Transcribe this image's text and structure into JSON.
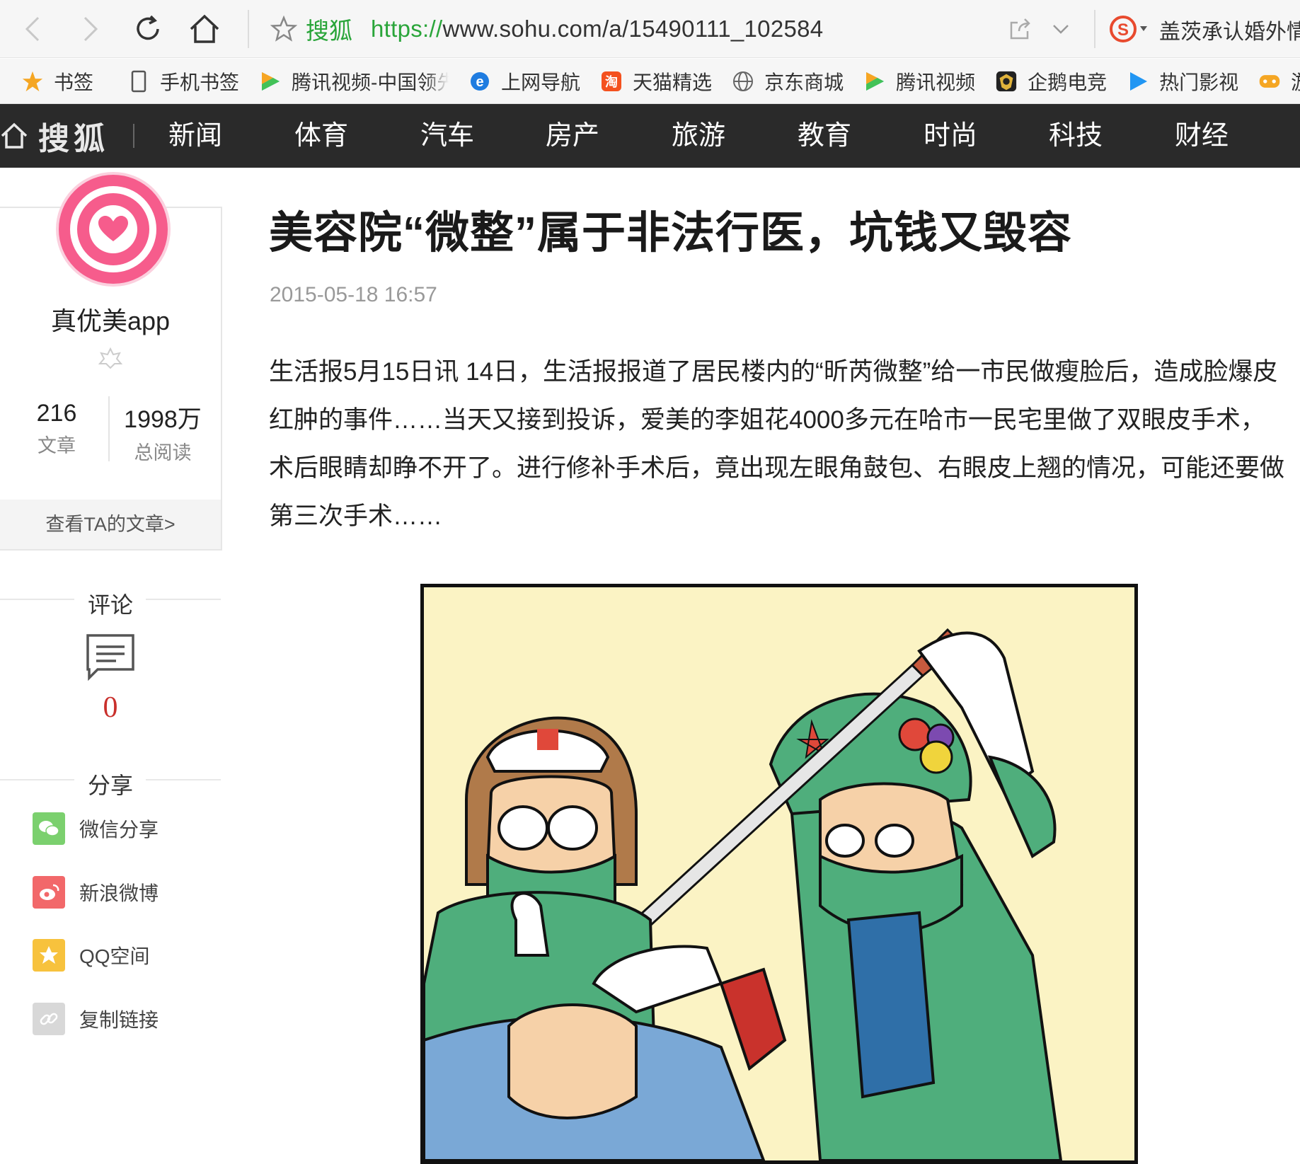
{
  "browser": {
    "site_name": "搜狐",
    "url_scheme": "https://",
    "url_rest": "www.sohu.com/a/15490111_102584",
    "news_ticker": "盖茨承认婚外情"
  },
  "bookmarks": [
    {
      "label": "书签",
      "icon": "star-icon"
    },
    {
      "label": "手机书签",
      "icon": "phone-icon"
    },
    {
      "label": "腾讯视频-中国领先",
      "icon": "tencent-video-icon"
    },
    {
      "label": "上网导航",
      "icon": "ie-icon"
    },
    {
      "label": "天猫精选",
      "icon": "taobao-icon"
    },
    {
      "label": "京东商城",
      "icon": "globe-icon"
    },
    {
      "label": "腾讯视频",
      "icon": "tencent-video-icon"
    },
    {
      "label": "企鹅电竞",
      "icon": "penguin-esports-icon"
    },
    {
      "label": "热门影视",
      "icon": "play-icon"
    },
    {
      "label": "游戏",
      "icon": "gamepad-icon"
    }
  ],
  "sitenav": {
    "logo": "搜狐",
    "items": [
      "新闻",
      "体育",
      "汽车",
      "房产",
      "旅游",
      "教育",
      "时尚",
      "科技",
      "财经"
    ]
  },
  "author": {
    "name": "真优美app",
    "articles_count": "216",
    "articles_label": "文章",
    "reads_count": "1998万",
    "reads_label": "总阅读",
    "view_link": "查看TA的文章>"
  },
  "comments": {
    "title": "评论",
    "count": "0"
  },
  "share": {
    "title": "分享",
    "items": [
      {
        "label": "微信分享",
        "color": "#7bd06e",
        "icon": "wechat-icon"
      },
      {
        "label": "新浪微博",
        "color": "#f2686a",
        "icon": "weibo-icon"
      },
      {
        "label": "QQ空间",
        "color": "#f7c23d",
        "icon": "qzone-icon"
      },
      {
        "label": "复制链接",
        "color": "#d8d8d8",
        "icon": "link-icon"
      }
    ]
  },
  "article": {
    "title": "美容院“微整”属于非法行医，坑钱又毁容",
    "date": "2015-05-18 16:57",
    "body": "生活报5月15日讯 14日，生活报报道了居民楼内的“昕芮微整”给一市民做瘦脸后，造成脸爆皮红肿的事件……当天又接到投诉，爱美的李姐花4000多元在哈市一民宅里做了双眼皮手术，术后眼睛却睁不开了。进行修补手术后，竟出现左眼角鼓包、右眼皮上翘的情况，可能还要做第三次手术……"
  },
  "colors": {
    "nav_bg": "#2a2a2a",
    "accent_green": "#2aa53a",
    "avatar_pink": "#f65c8c",
    "comment_red": "#c9302c"
  }
}
